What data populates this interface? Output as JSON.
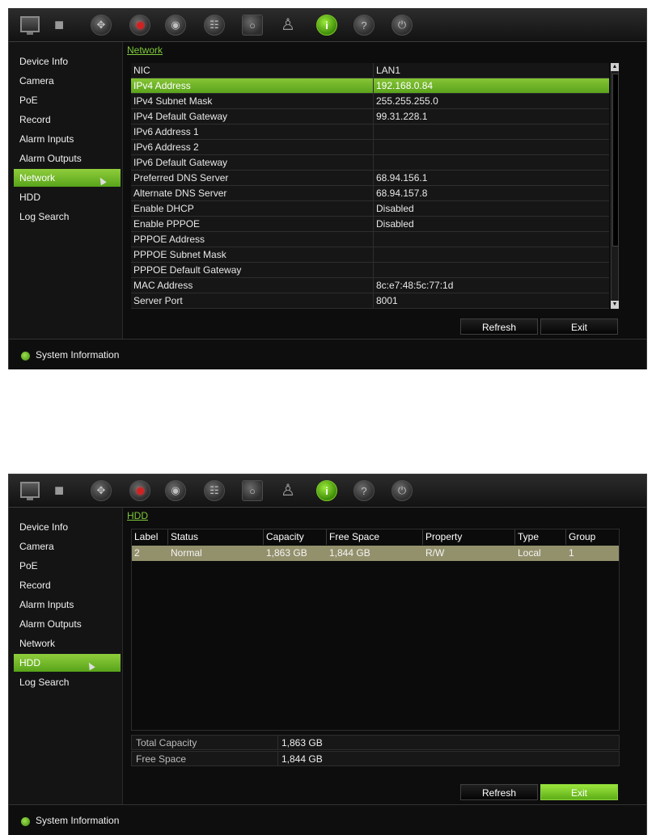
{
  "screens": [
    {
      "sidebar": [
        "Device Info",
        "Camera",
        "PoE",
        "Record",
        "Alarm Inputs",
        "Alarm Outputs",
        "Network",
        "HDD",
        "Log Search"
      ],
      "active_item": "Network",
      "title": "Network",
      "network_rows": [
        {
          "label": "NIC",
          "value": "LAN1"
        },
        {
          "label": "IPv4 Address",
          "value": "192.168.0.84"
        },
        {
          "label": "IPv4 Subnet Mask",
          "value": "255.255.255.0"
        },
        {
          "label": "IPv4 Default Gateway",
          "value": "99.31.228.1"
        },
        {
          "label": "IPv6 Address 1",
          "value": ""
        },
        {
          "label": "IPv6 Address 2",
          "value": ""
        },
        {
          "label": "IPv6 Default Gateway",
          "value": ""
        },
        {
          "label": "Preferred DNS Server",
          "value": "68.94.156.1"
        },
        {
          "label": "Alternate DNS Server",
          "value": "68.94.157.8"
        },
        {
          "label": "Enable DHCP",
          "value": "Disabled"
        },
        {
          "label": "Enable PPPOE",
          "value": "Disabled"
        },
        {
          "label": "PPPOE Address",
          "value": ""
        },
        {
          "label": "PPPOE Subnet Mask",
          "value": ""
        },
        {
          "label": "PPPOE Default Gateway",
          "value": ""
        },
        {
          "label": "MAC Address",
          "value": "8c:e7:48:5c:77:1d"
        },
        {
          "label": "Server Port",
          "value": "8001"
        }
      ],
      "selected_row": "IPv4 Address",
      "buttons": {
        "refresh": "Refresh",
        "exit": "Exit"
      },
      "status": "System Information"
    },
    {
      "sidebar": [
        "Device Info",
        "Camera",
        "PoE",
        "Record",
        "Alarm Inputs",
        "Alarm Outputs",
        "Network",
        "HDD",
        "Log Search"
      ],
      "active_item": "HDD",
      "title": "HDD",
      "hdd_columns": [
        "Label",
        "Status",
        "Capacity",
        "Free Space",
        "Property",
        "Type",
        "Group"
      ],
      "hdd_rows": [
        [
          "2",
          "Normal",
          "1,863 GB",
          "1,844 GB",
          "R/W",
          "Local",
          "1"
        ]
      ],
      "summary": [
        {
          "label": "Total Capacity",
          "value": "1,863 GB"
        },
        {
          "label": "Free Space",
          "value": "1,844 GB"
        }
      ],
      "buttons": {
        "refresh": "Refresh",
        "exit": "Exit"
      },
      "status": "System Information"
    }
  ],
  "toolbar_icons": [
    "monitor-icon",
    "camera-icon",
    "ptz-icon",
    "record-icon",
    "alarm-icon",
    "network-icon",
    "hdd-icon",
    "user-icon",
    "info-icon",
    "help-icon",
    "power-icon"
  ],
  "colors": {
    "accent_green": "#7fc93a",
    "selection_green": "#6fb62a",
    "hdd_row": "#93916c"
  }
}
